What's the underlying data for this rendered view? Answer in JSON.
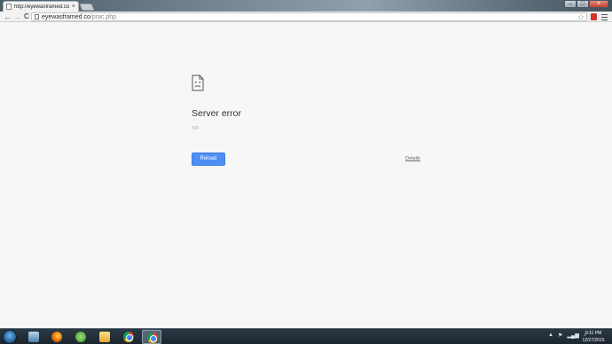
{
  "browser": {
    "tab": {
      "title": "http://eyewasframed.co/p",
      "close_glyph": "×"
    },
    "window_controls": {
      "minimize": "–",
      "maximize": "□",
      "close": "×"
    },
    "nav": {
      "back": "←",
      "forward": "→",
      "reload": "C"
    },
    "address": {
      "domain": "eyewasframed.co",
      "path": "/prac.php"
    },
    "star": "☆"
  },
  "error_page": {
    "title": "Server error",
    "code": "500",
    "reload_label": "Reload",
    "details_label": "Details"
  },
  "taskbar": {
    "apps": [
      {
        "name": "windows-explorer",
        "icon": "explorer-icon"
      },
      {
        "name": "firefox",
        "icon": "firefox-icon"
      },
      {
        "name": "utorrent",
        "icon": "utorrent-icon"
      },
      {
        "name": "file-explorer",
        "icon": "folder-icon"
      },
      {
        "name": "chrome",
        "icon": "chrome-icon"
      },
      {
        "name": "chrome-active",
        "icon": "chrome-icon"
      }
    ],
    "tray": {
      "arrow": "▲",
      "flag": "⚑",
      "signal": "▂▄▆",
      "volume": "♪"
    },
    "clock": {
      "time": "9:11 PM",
      "date": "12/27/2015"
    }
  },
  "colors": {
    "accent": "#4d8ff2",
    "page_bg": "#f7f7f7"
  }
}
